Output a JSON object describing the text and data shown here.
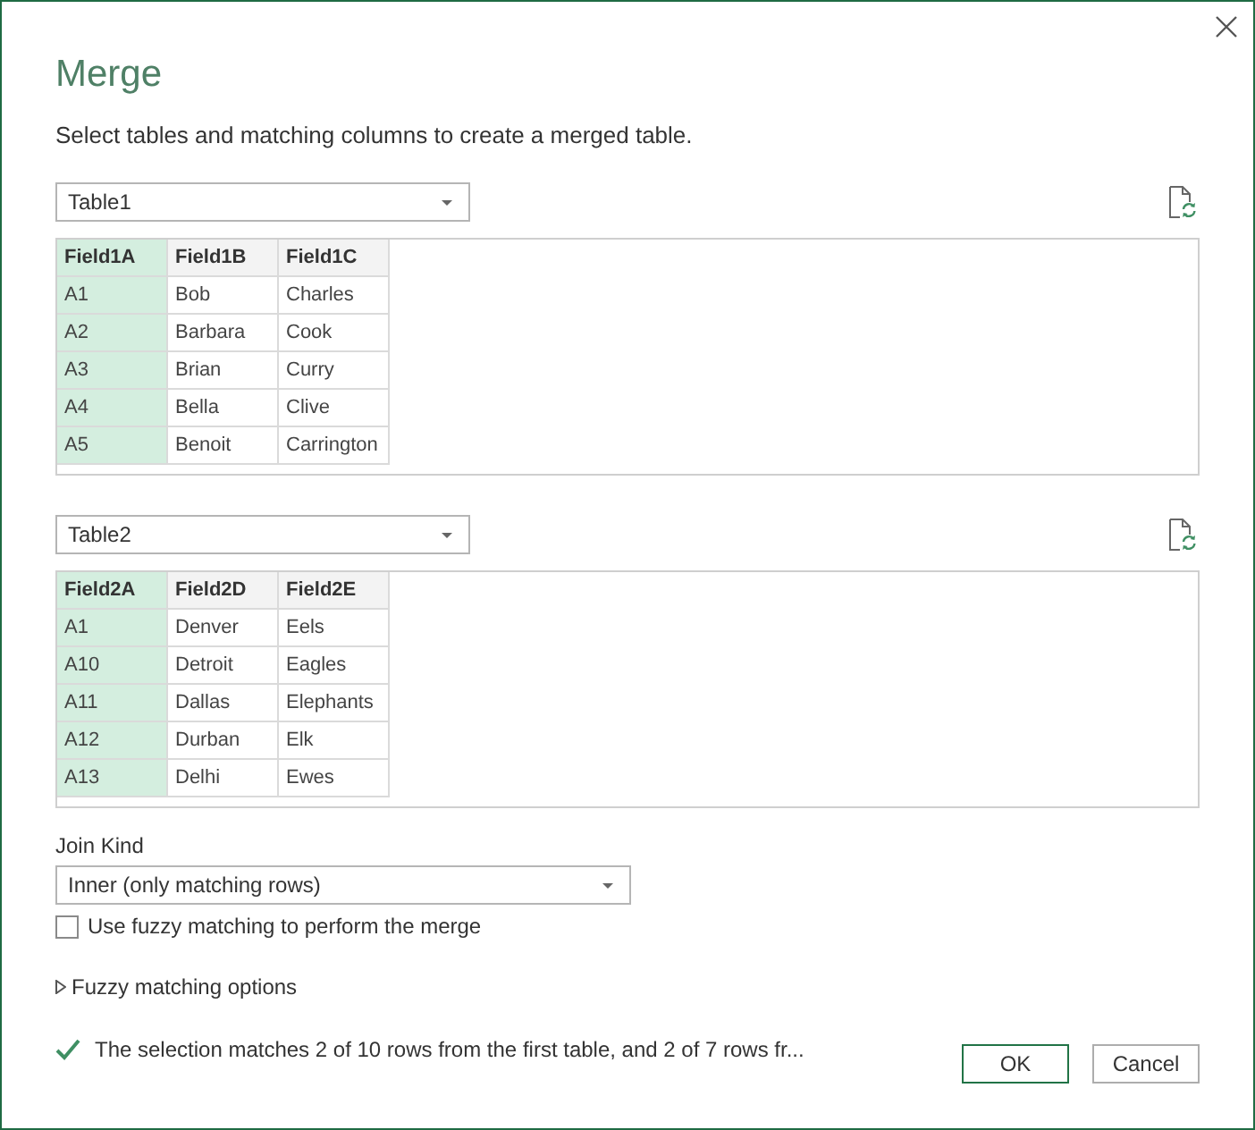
{
  "window": {
    "title": "Merge",
    "subtitle": "Select tables and matching columns to create a merged table."
  },
  "tables": [
    {
      "source": "Table1",
      "columns": [
        {
          "name": "Field1A",
          "selected": true
        },
        {
          "name": "Field1B",
          "selected": false
        },
        {
          "name": "Field1C",
          "selected": false
        }
      ],
      "rows": [
        [
          "A1",
          "Bob",
          "Charles"
        ],
        [
          "A2",
          "Barbara",
          "Cook"
        ],
        [
          "A3",
          "Brian",
          "Curry"
        ],
        [
          "A4",
          "Bella",
          "Clive"
        ],
        [
          "A5",
          "Benoit",
          "Carrington"
        ]
      ]
    },
    {
      "source": "Table2",
      "columns": [
        {
          "name": "Field2A",
          "selected": true
        },
        {
          "name": "Field2D",
          "selected": false
        },
        {
          "name": "Field2E",
          "selected": false
        }
      ],
      "rows": [
        [
          "A1",
          "Denver",
          "Eels"
        ],
        [
          "A10",
          "Detroit",
          "Eagles"
        ],
        [
          "A11",
          "Dallas",
          "Elephants"
        ],
        [
          "A12",
          "Durban",
          "Elk"
        ],
        [
          "A13",
          "Delhi",
          "Ewes"
        ]
      ]
    }
  ],
  "join_kind": {
    "label": "Join Kind",
    "value": "Inner (only matching rows)"
  },
  "fuzzy_matching": {
    "label": "Use fuzzy matching to perform the merge",
    "checked": false
  },
  "fuzzy_options": {
    "label": "Fuzzy matching options",
    "expanded": false
  },
  "status": {
    "valid": true,
    "text": "The selection matches 2 of 10 rows from the first table, and 2 of 7 rows fr..."
  },
  "buttons": [
    {
      "label": "OK",
      "default": true
    },
    {
      "label": "Cancel",
      "default": false
    }
  ]
}
